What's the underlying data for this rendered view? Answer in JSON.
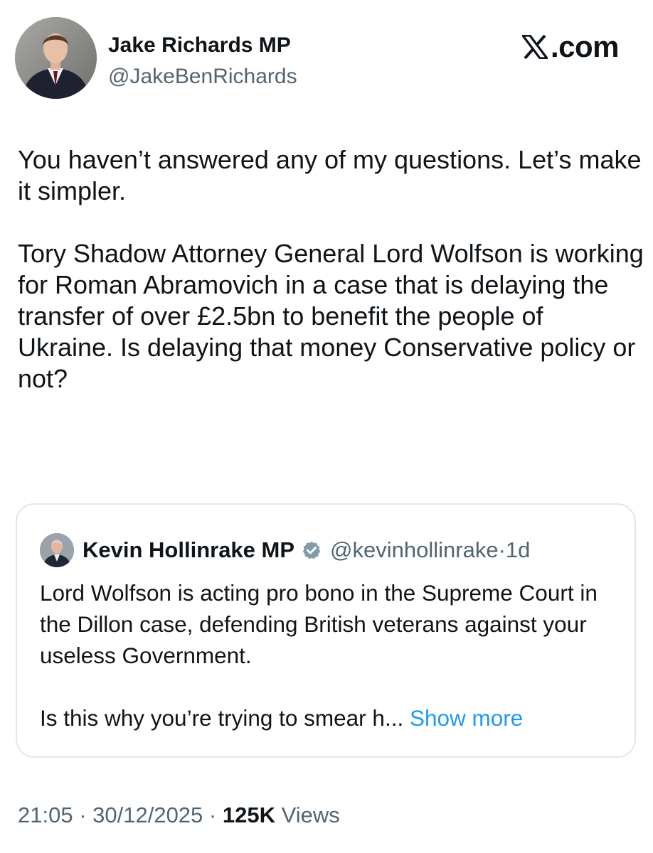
{
  "author": {
    "name": "Jake Richards MP",
    "handle": "@JakeBenRichards"
  },
  "brand": {
    "text": ".com",
    "icon": "x-logo-icon"
  },
  "tweet": {
    "paragraph_1": "You haven’t answered any of my questions. Let’s make it simpler.",
    "paragraph_2": "Tory Shadow Attorney General Lord Wolfson is working for Roman Abramovich in a case that is delaying the transfer of over £2.5bn to benefit the people of Ukraine. Is delaying that money Conservative policy or not?"
  },
  "quote": {
    "name": "Kevin Hollinrake MP",
    "verified_icon": "verified-badge-icon",
    "verified_color": "#829aab",
    "handle": "@kevinhollinrake",
    "dot": "·",
    "time": "1d",
    "paragraph_1": "Lord Wolfson is acting pro bono in the Supreme Court in the Dillon case, defending British veterans against your useless Government.",
    "paragraph_2": "Is this why you’re trying to smear h",
    "ellipsis": "...",
    "show_more": "Show more"
  },
  "meta": {
    "time": "21:05",
    "sep1": " · ",
    "date": "30/12/2025",
    "sep2": " · ",
    "views_count": "125K",
    "views_label": " Views"
  },
  "colors": {
    "text": "#0f1419",
    "secondary": "#536471",
    "link": "#1d9bf0",
    "border": "#e3e6e9"
  }
}
